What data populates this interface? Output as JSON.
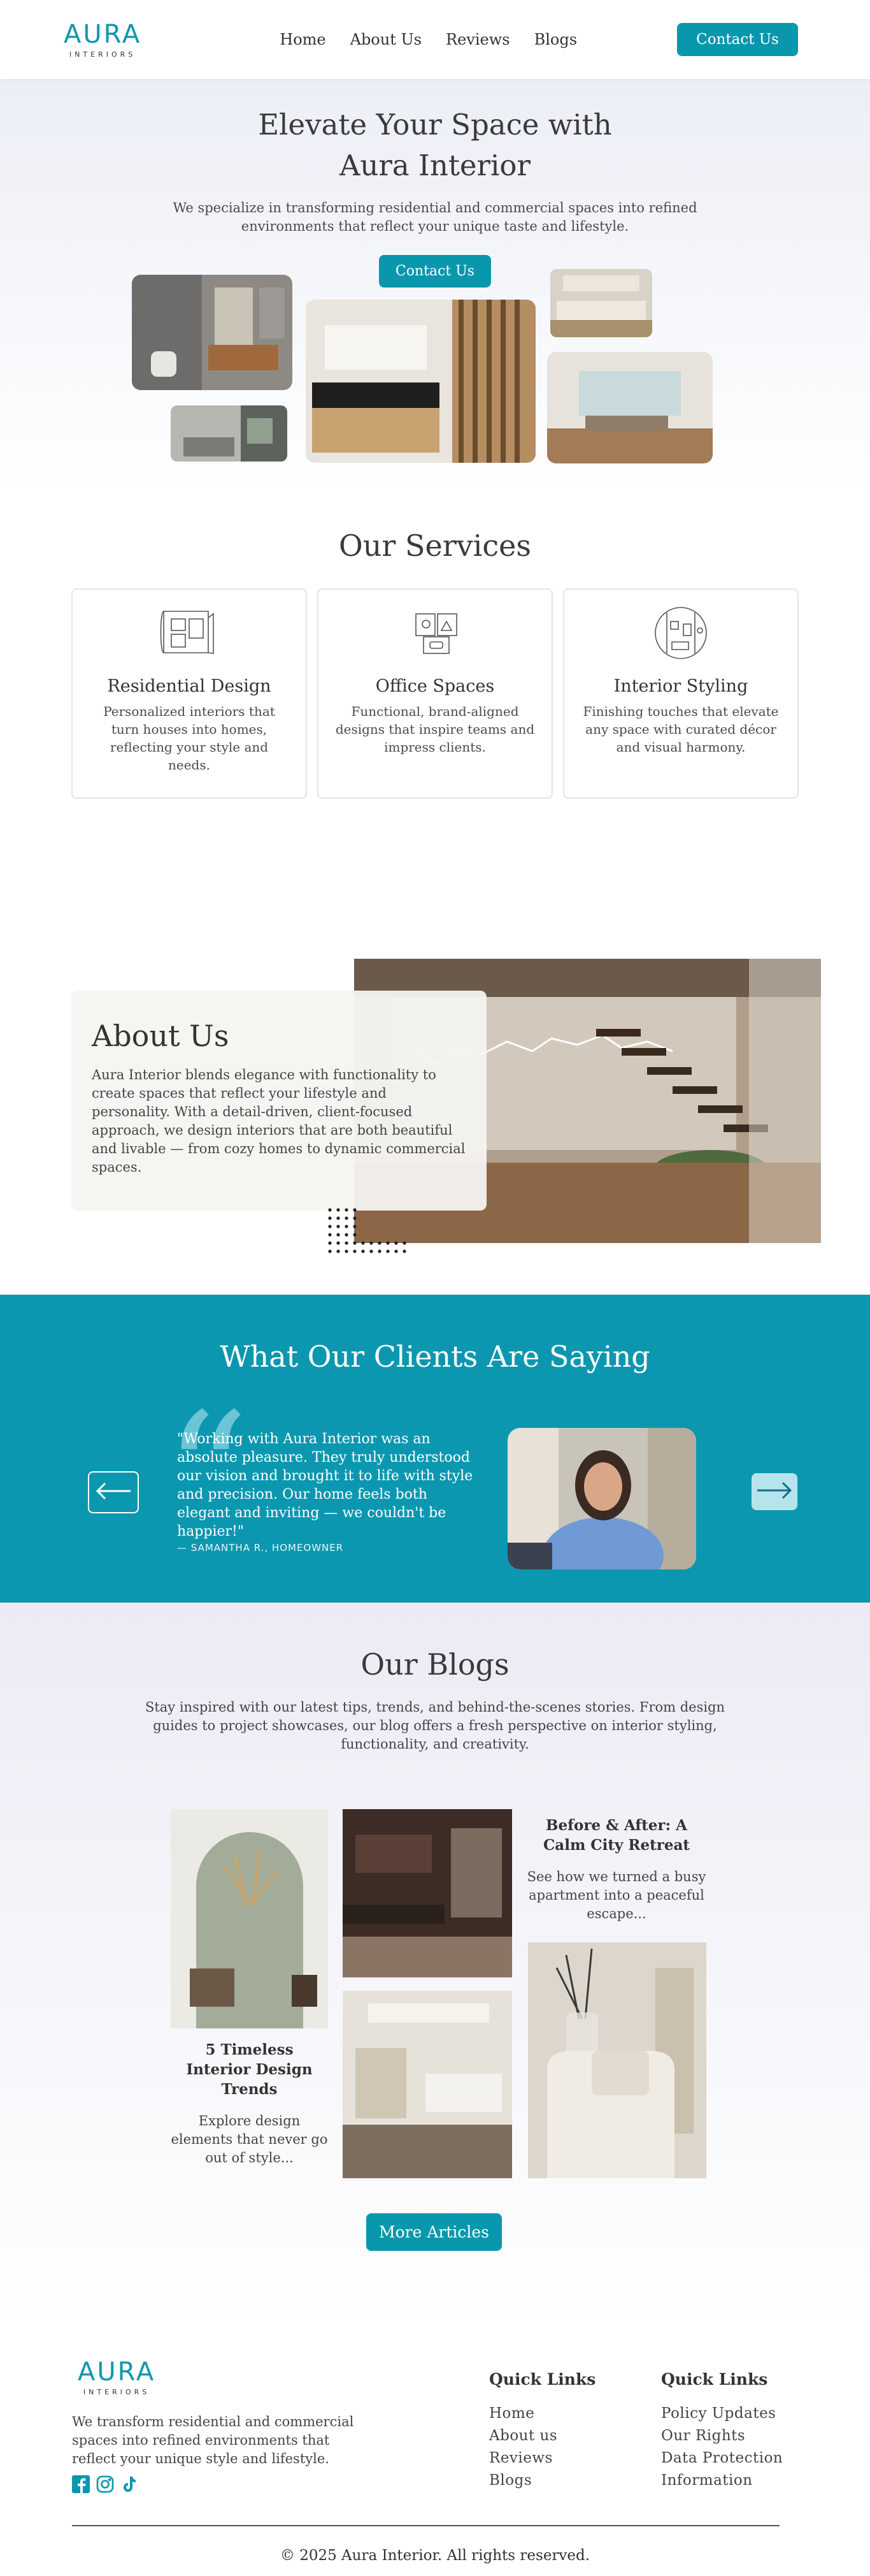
{
  "brand": {
    "name": "AURA",
    "tagline": "INTERIORS"
  },
  "nav": {
    "links": [
      "Home",
      "About Us",
      "Reviews",
      "Blogs"
    ],
    "cta": "Contact Us"
  },
  "hero": {
    "title_line1": "Elevate Your Space with",
    "title_line2": "Aura Interior",
    "subtitle": "We specialize in transforming residential and commercial spaces into refined environments that reflect your unique taste and lifestyle.",
    "cta": "Contact Us"
  },
  "services": {
    "title": "Our Services",
    "items": [
      {
        "title": "Residential Design",
        "text": "Personalized interiors that turn houses into homes, reflecting your style and needs."
      },
      {
        "title": "Office Spaces",
        "text": "Functional, brand-aligned designs that inspire teams and impress clients."
      },
      {
        "title": "Interior Styling",
        "text": "Finishing touches that elevate any space with curated décor and visual harmony."
      }
    ]
  },
  "about": {
    "title": "About Us",
    "text": "Aura Interior blends elegance with functionality to create spaces that reflect your lifestyle and personality. With a detail-driven, client-focused approach, we design interiors that are both beautiful and livable — from cozy homes to dynamic commercial spaces."
  },
  "testimonials": {
    "title": "What Our Clients Are Saying",
    "quote": "\"Working with Aura Interior was an absolute pleasure. They truly understood our vision and brought it to life with style and precision. Our home feels both elegant and inviting — we couldn't be happier!\"",
    "author": "— SAMANTHA R., HOMEOWNER"
  },
  "blogs": {
    "title": "Our Blogs",
    "intro": "Stay inspired with our latest tips, trends, and behind-the-scenes stories. From design guides to project showcases, our blog offers a fresh perspective on interior styling, functionality, and creativity.",
    "post1": {
      "title": "5 Timeless Interior Design Trends",
      "excerpt": "Explore design elements that never go out of style..."
    },
    "post2": {
      "title": "Before & After: A Calm City Retreat",
      "excerpt": "See how we turned a busy apartment into a peaceful escape..."
    },
    "cta": "More Articles"
  },
  "footer": {
    "tagline": "We transform residential and commercial spaces into refined environments that reflect your unique style and lifestyle.",
    "col1": {
      "title": "Quick Links",
      "links": [
        "Home",
        "About us",
        "Reviews",
        "Blogs"
      ]
    },
    "col2": {
      "title": "Quick Links",
      "links": [
        "Policy Updates",
        "Our Rights",
        "Data Protection",
        "Information"
      ]
    },
    "copyright": "© 2025 Aura Interior. All rights reserved."
  },
  "colors": {
    "accent": "#0997ae",
    "testimonial_bg": "#0c97b0"
  },
  "icons": [
    "blueprint-icon",
    "office-furniture-icon",
    "styling-room-icon",
    "arrow-left-icon",
    "arrow-right-icon",
    "facebook-icon",
    "instagram-icon",
    "tiktok-icon"
  ]
}
